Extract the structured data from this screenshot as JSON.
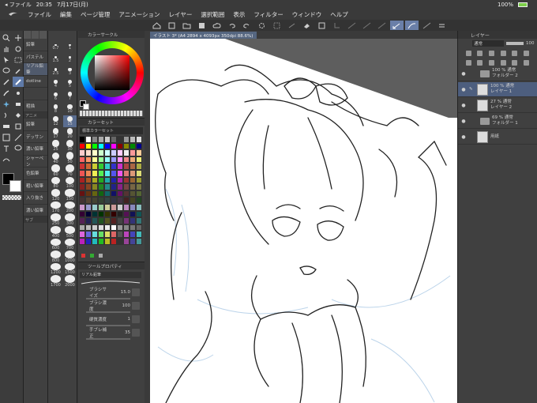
{
  "status_bar": {
    "back_label": "◂ ファイル",
    "time": "20:35",
    "date": "7月17日(月)",
    "battery": "100%"
  },
  "menu": [
    "ファイル",
    "編集",
    "ページ管理",
    "アニメーション",
    "レイヤー",
    "選択範囲",
    "表示",
    "フィルター",
    "ウィンドウ",
    "ヘルプ"
  ],
  "subtool": {
    "items": [
      "鉛筆",
      "パステル",
      "リアル鉛筆",
      "dotline",
      "",
      "粗描",
      "鉛筆",
      "デッサン",
      "濃い鉛筆",
      "シャーペン",
      "色鉛筆",
      "粗い鉛筆",
      "入り抜き",
      "濃い鉛筆"
    ],
    "groups": [
      "アニメ",
      "サブ"
    ]
  },
  "brush_sizes": [
    "0.7",
    "1",
    "1.5",
    "2",
    "2.5",
    "3",
    "4",
    "5",
    "6",
    "7",
    "8",
    "10",
    "12",
    "15",
    "17",
    "20",
    "25",
    "30",
    "40",
    "50",
    "60",
    "70",
    "80",
    "100",
    "120",
    "150",
    "170",
    "200",
    "250",
    "300",
    "400",
    "500",
    "600",
    "700",
    "800",
    "1000",
    "1200",
    "1500",
    "1700",
    "2000"
  ],
  "color_circle": {
    "title": "カラーサークル"
  },
  "color_set": {
    "title": "カラーセット",
    "selector": "標準カラーセット"
  },
  "tool_property": {
    "title": "ツールプロパティ",
    "brush_name": "リアル鉛筆",
    "rows": [
      {
        "label": "ブラシサイズ",
        "value": "15.0"
      },
      {
        "label": "ブラシ濃度",
        "value": "100"
      },
      {
        "label": "硬質濃度",
        "value": "1"
      },
      {
        "label": "手ブレ補正",
        "value": "35"
      }
    ]
  },
  "canvas": {
    "tab_title": "イラスト 3* (A4 2894 x 4093px 350dpi 88.6%)"
  },
  "layers": {
    "tab": "レイヤー",
    "blend_mode": "通常",
    "opacity": "100",
    "items": [
      {
        "opacity": "100 %",
        "mode": "通常",
        "name": "フォルダー 2",
        "kind": "folder"
      },
      {
        "opacity": "100 %",
        "mode": "通常",
        "name": "レイヤー 1",
        "kind": "layer",
        "active": true
      },
      {
        "opacity": "27 %",
        "mode": "通常",
        "name": "レイヤー 2",
        "kind": "layer"
      },
      {
        "opacity": "69 %",
        "mode": "通常",
        "name": "フォルダー 1",
        "kind": "folder"
      },
      {
        "opacity": "",
        "mode": "",
        "name": "用紙",
        "kind": "paper"
      }
    ]
  },
  "colors": {
    "accent": "#5f7aa8",
    "panel_bg": "#404040",
    "canvas_bg": "#5e5e5e"
  }
}
